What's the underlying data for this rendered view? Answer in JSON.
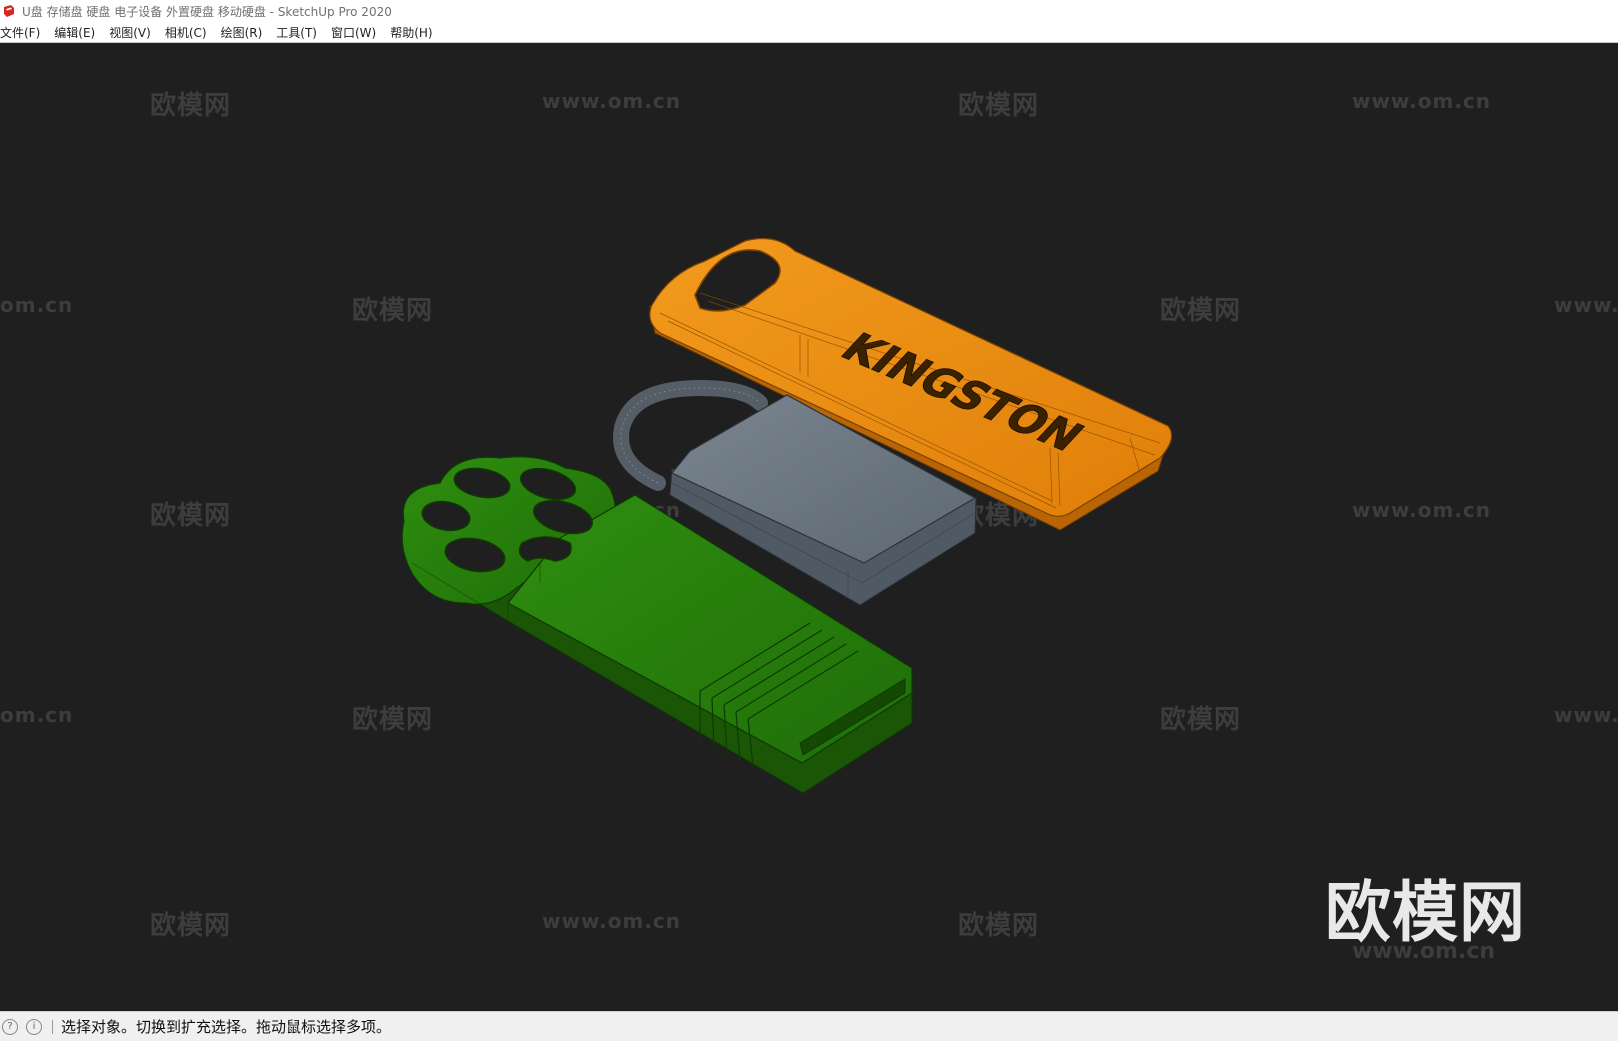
{
  "window": {
    "title": "U盘 存储盘 硬盘 电子设备 外置硬盘 移动硬盘 - SketchUp Pro 2020"
  },
  "menu": {
    "items": [
      {
        "label": "文件(F)"
      },
      {
        "label": "编辑(E)"
      },
      {
        "label": "视图(V)"
      },
      {
        "label": "相机(C)"
      },
      {
        "label": "绘图(R)"
      },
      {
        "label": "工具(T)"
      },
      {
        "label": "窗口(W)"
      },
      {
        "label": "帮助(H)"
      }
    ]
  },
  "watermarks": {
    "brand": "欧模网",
    "url": "www.om.cn",
    "url_partial_left": "om.cn",
    "url_partial_right": "www.",
    "big_brand": "欧模网"
  },
  "model": {
    "engraved_text": "KINGSTON"
  },
  "status": {
    "message": "选择对象。切换到扩充选择。拖动鼠标选择多项。"
  },
  "colors": {
    "viewport_bg": "#1f1f1f",
    "orange_drive": "#e8870c",
    "gray_drive": "#6f7a86",
    "green_drive": "#2e8a0e",
    "title_icon": "#d9261c"
  },
  "icons": {
    "app": "sketchup-logo-icon",
    "status_geo": "geolocation-icon",
    "status_info": "info-icon"
  }
}
